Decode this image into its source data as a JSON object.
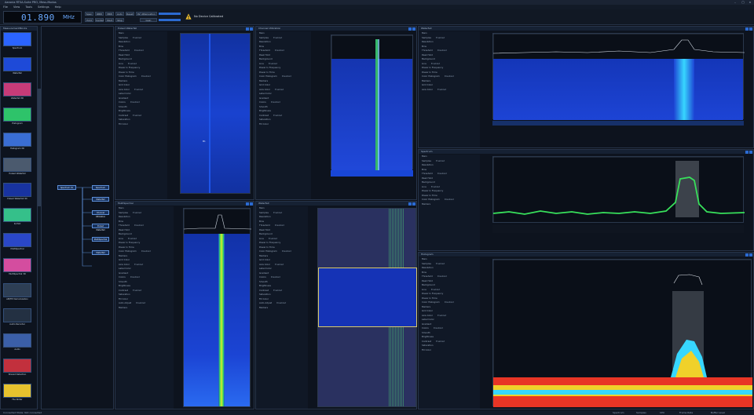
{
  "window": {
    "title": "Aaronia RTSA-Suite PRO, Mess-Modus",
    "menu": [
      "File",
      "View",
      "Tools",
      "Settings",
      "Help"
    ]
  },
  "toolbar": {
    "frequency": "01.890",
    "frequency_unit": "MHz",
    "warning_text": "No Device Calibrated",
    "buttons": [
      "Span",
      "RBW",
      "VBW",
      "Auto",
      "Reset",
      "Peak",
      "Hold",
      "Center",
      "Start",
      "Stop",
      "Attenuation",
      "Gain"
    ]
  },
  "left_sidebar": {
    "header": "MeasurementBlocks",
    "items": [
      {
        "label": "Spectrum",
        "color": "#2b64ff"
      },
      {
        "label": "Waterfall",
        "color": "#1e4ad8"
      },
      {
        "label": "Waterfall 3D",
        "color": "#c73b78"
      },
      {
        "label": "Histogram",
        "color": "#2ec36a"
      },
      {
        "label": "Histogram 3D",
        "color": "#3a6ed4"
      },
      {
        "label": "Pulsed Waterfall",
        "color": "#4b5a6e"
      },
      {
        "label": "Pulsed Waterfall 3D",
        "color": "#1833a0"
      },
      {
        "label": "IQ Plot",
        "color": "#35c08a"
      },
      {
        "label": "MultiSpectral",
        "color": "#2a47c8"
      },
      {
        "label": "MultiSpectral 3D",
        "color": "#d44d9f"
      },
      {
        "label": "AM/FM Demodulation",
        "color": "#2d3e54"
      },
      {
        "label": "Audio Recorder",
        "color": "#233042"
      },
      {
        "label": "Audio",
        "color": "#3b5fa8"
      },
      {
        "label": "Shared Detection",
        "color": "#c2303d"
      },
      {
        "label": "File Writer",
        "color": "#e7c22e"
      }
    ]
  },
  "flow": {
    "source": "Spectrum 01",
    "targets": [
      "Spectrum",
      "Waterfall",
      "Channel Utilization",
      "Pulsed Waterfall",
      "MultiSpectral",
      "Waterfall"
    ]
  },
  "panels": {
    "pulsed": "Pulsed Waterfall",
    "channel": "Channel Utilization",
    "waterfall_top": "Waterfall",
    "spectrum": "Spectrum",
    "multispectral": "MultiSpectral",
    "waterfall_mid": "Waterfall",
    "histogram": "Histogram"
  },
  "options": {
    "common": [
      "Main",
      "Samples",
      "Resolution",
      "Bins",
      "Threshold",
      "Peak Hold",
      "Background",
      "Line",
      "Power In Frequency",
      "Power In Time",
      "Color Histogram",
      "Markers",
      "Grid Color",
      "Axis Color",
      "Label Color",
      "Gradient",
      "Colors",
      "Smooth",
      "Brightness",
      "Contrast",
      "Saturation",
      "Fill Color",
      "Auto Adjust",
      "Markers"
    ],
    "state_enabled": "Enabled",
    "state_disabled": "Disabled"
  },
  "status": {
    "left": "Connected Mode: Not connected",
    "right_items": [
      "Spectrum",
      "Samples",
      "CPU",
      "Frame Rate",
      "Buffer Level"
    ]
  },
  "colors": {
    "accent": "#2b6ad1",
    "trace_green": "#38e05b",
    "waterfall_blue": "#1a45d9",
    "heat_red": "#e83525",
    "heat_yellow": "#f0d12a",
    "heat_cyan": "#37d7ff"
  }
}
